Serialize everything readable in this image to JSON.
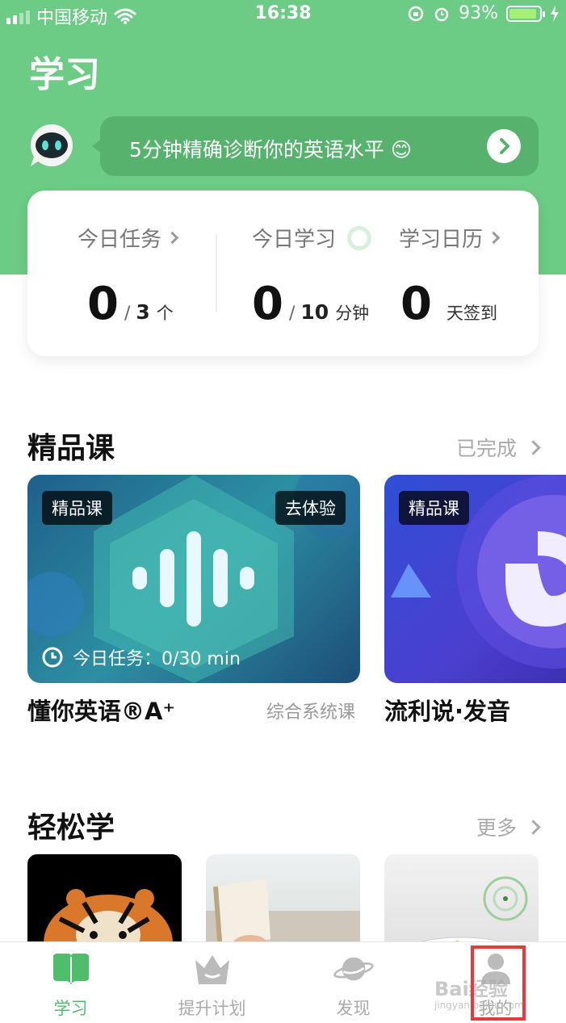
{
  "status_bar": {
    "carrier": "中国移动",
    "time": "16:38",
    "battery": "93%",
    "battery_level": 0.93
  },
  "header": {
    "title": "学习"
  },
  "assistant": {
    "prompt": "5分钟精确诊断你的英语水平 😊"
  },
  "stats": {
    "today_task": {
      "label": "今日任务",
      "value": "0",
      "total": "3",
      "unit": "个"
    },
    "today_study": {
      "label": "今日学习",
      "value": "0",
      "total": "10",
      "unit": "分钟"
    },
    "calendar": {
      "label": "学习日历",
      "value": "0",
      "unit": "天签到"
    }
  },
  "premium": {
    "title": "精品课",
    "link": "已完成",
    "courses": [
      {
        "tag": "精品课",
        "action": "去体验",
        "task": "今日任务：0/30 min",
        "name": "懂你英语®A⁺",
        "subtitle": "综合系统课"
      },
      {
        "tag": "精品课",
        "name": "流利说·发音"
      }
    ]
  },
  "easy": {
    "title": "轻松学",
    "link": "更多"
  },
  "nav": [
    {
      "label": "学习",
      "icon": "book-icon",
      "active": true
    },
    {
      "label": "提升计划",
      "icon": "crown-icon",
      "active": false
    },
    {
      "label": "发现",
      "icon": "planet-icon",
      "active": false
    },
    {
      "label": "我的",
      "icon": "profile-icon",
      "active": false
    }
  ],
  "watermark": {
    "text": "Bai经验",
    "sub": "jingyan.baidu.com"
  },
  "colors": {
    "brand_green": "#6ccb84",
    "active_green": "#4fbd6a",
    "highlight": "#e83a3a"
  }
}
